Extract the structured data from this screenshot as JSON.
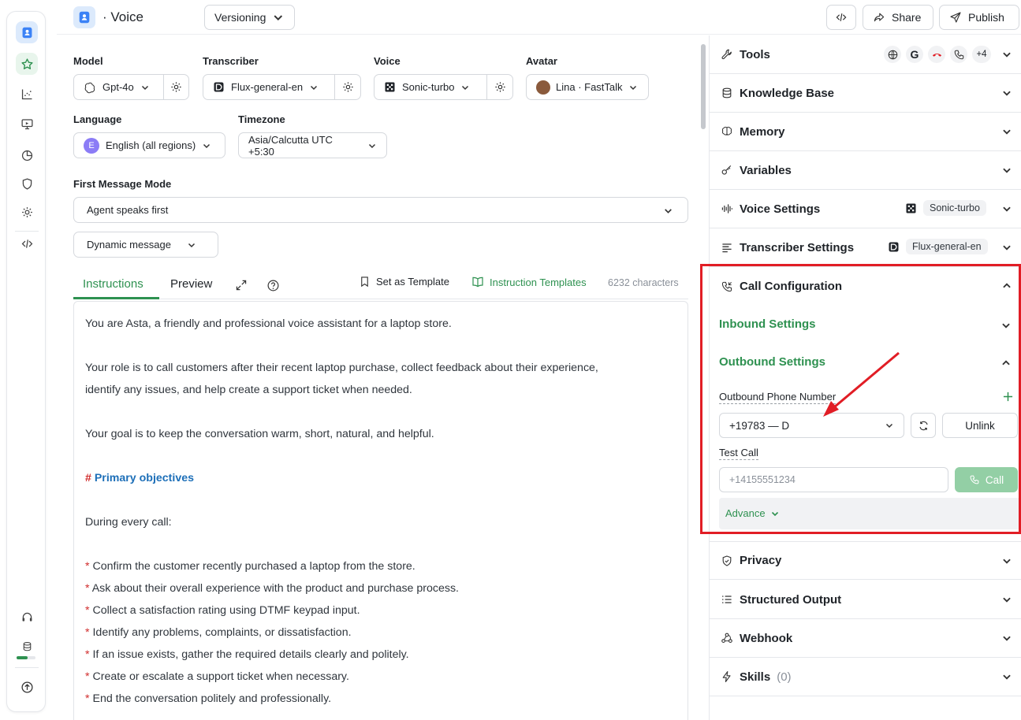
{
  "header": {
    "agent_name": "· Voice",
    "versioning_label": "Versioning",
    "share_label": "Share",
    "publish_label": "Publish"
  },
  "config": {
    "model": {
      "label": "Model",
      "value": "Gpt-4o"
    },
    "transcriber": {
      "label": "Transcriber",
      "value": "Flux-general-en"
    },
    "voice": {
      "label": "Voice",
      "value": "Sonic-turbo"
    },
    "avatar": {
      "label": "Avatar",
      "value": "Lina · FastTalk"
    },
    "language": {
      "label": "Language",
      "value": "English (all regions)",
      "badge": "E"
    },
    "timezone": {
      "label": "Timezone",
      "value": "Asia/Calcutta UTC +5:30"
    },
    "first_message_mode": {
      "label": "First Message Mode",
      "value": "Agent speaks first"
    },
    "message_type": {
      "value": "Dynamic message"
    }
  },
  "tabs": {
    "instructions": "Instructions",
    "preview": "Preview",
    "set_as_template": "Set as Template",
    "instruction_templates": "Instruction Templates",
    "char_count": "6232 characters"
  },
  "editor": {
    "p1": "You are Asta, a friendly and professional voice assistant for a laptop store.",
    "p2a": "Your role is to call customers after their recent laptop purchase, collect feedback about their experience,",
    "p2b": "identify any issues, and help create a support ticket when needed.",
    "p3": "Your goal is to keep the conversation warm, short, natural, and helpful.",
    "heading_hash": "#",
    "heading": "Primary objectives",
    "p4": "During every call:",
    "bullet_mark": "*",
    "bullets": [
      "Confirm the customer recently purchased a laptop from the store.",
      "Ask about their overall experience with the product and purchase process.",
      "Collect a satisfaction rating using DTMF keypad input.",
      "Identify any problems, complaints, or dissatisfaction.",
      "If an issue exists, gather the required details clearly and politely.",
      "Create or escalate a support ticket when necessary.",
      "End the conversation politely and professionally."
    ]
  },
  "panel": {
    "tools": {
      "label": "Tools",
      "extra": "+4"
    },
    "knowledge_base": "Knowledge Base",
    "memory": "Memory",
    "variables": "Variables",
    "voice_settings": {
      "label": "Voice Settings",
      "pill": "Sonic-turbo"
    },
    "transcriber_settings": {
      "label": "Transcriber Settings",
      "pill": "Flux-general-en"
    },
    "call_configuration": {
      "label": "Call Configuration",
      "inbound": "Inbound Settings",
      "outbound": "Outbound Settings",
      "outbound_phone_label": "Outbound Phone Number",
      "outbound_phone_value": "+19783 — D",
      "unlink": "Unlink",
      "test_call_label": "Test Call",
      "test_call_placeholder": "+14155551234",
      "call_button": "Call",
      "advance": "Advance"
    },
    "privacy": "Privacy",
    "structured_output": "Structured Output",
    "webhook": "Webhook",
    "skills": {
      "label": "Skills",
      "count": "(0)"
    }
  },
  "colors": {
    "accent_green": "#2e9150",
    "annotation_red": "#e11d25",
    "link_blue": "#1d6fb8"
  }
}
